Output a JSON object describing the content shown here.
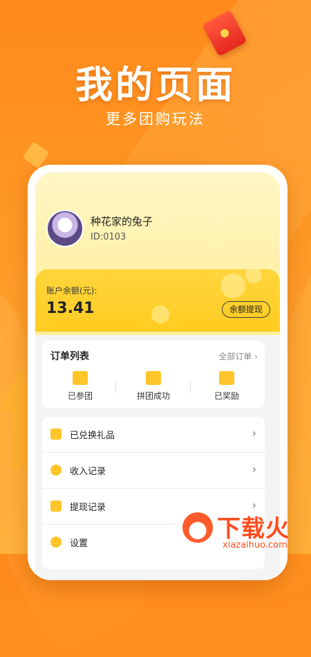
{
  "promo": {
    "title": "我的页面",
    "subtitle": "更多团购玩法"
  },
  "profile": {
    "name": "种花家的兔子",
    "id": "ID:0103"
  },
  "balance": {
    "label": "账户余额(元):",
    "value": "13.41",
    "withdraw_label": "余额提现"
  },
  "orders": {
    "title": "订单列表",
    "all_label": "全部订单",
    "items": [
      {
        "label": "已参团",
        "icon": "box-icon"
      },
      {
        "label": "拼团成功",
        "icon": "check-icon"
      },
      {
        "label": "已奖励",
        "icon": "yuan-icon"
      }
    ]
  },
  "menu": {
    "items": [
      {
        "label": "已兑换礼品",
        "icon": "gift-icon"
      },
      {
        "label": "收入记录",
        "icon": "yuan-coin-icon"
      },
      {
        "label": "提现记录",
        "icon": "wallet-icon"
      },
      {
        "label": "设置",
        "icon": "gear-icon"
      }
    ],
    "chevron": "›"
  },
  "watermark": {
    "brand": "下载火",
    "domain": "xiazaihuo.com"
  },
  "colors": {
    "background": "#ff9a26",
    "accent": "#ffc52a",
    "brand_red": "#ff4d1d"
  }
}
